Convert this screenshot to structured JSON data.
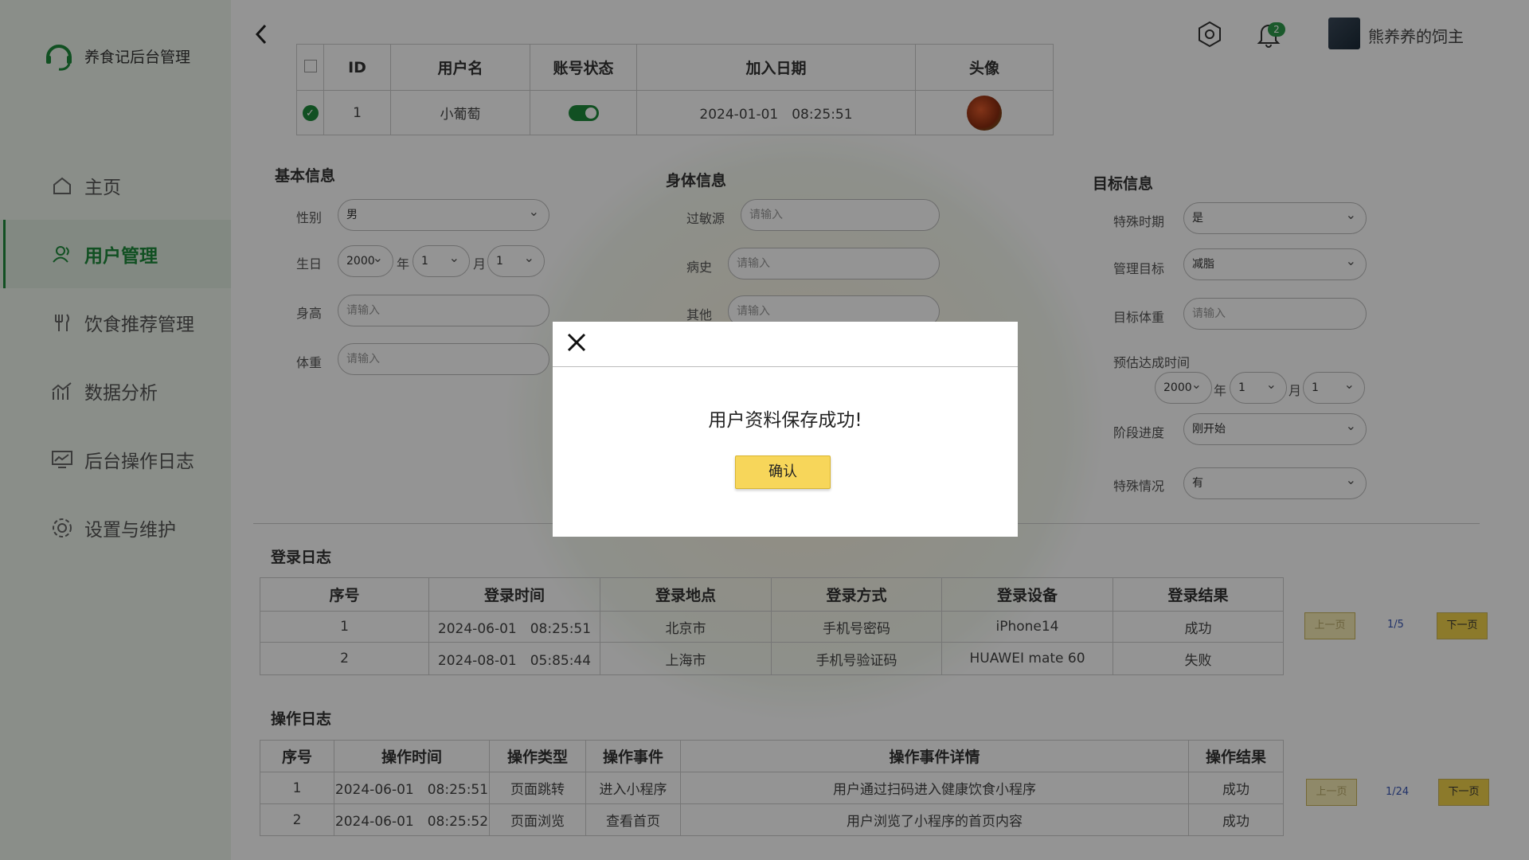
{
  "app": {
    "title": "养食记后台管理"
  },
  "sidebar": {
    "items": [
      {
        "label": "主页",
        "icon": "home-icon"
      },
      {
        "label": "用户管理",
        "icon": "user-icon",
        "active": true
      },
      {
        "label": "饮食推荐管理",
        "icon": "utensils-icon"
      },
      {
        "label": "数据分析",
        "icon": "chart-icon"
      },
      {
        "label": "后台操作日志",
        "icon": "monitor-icon"
      },
      {
        "label": "设置与维护",
        "icon": "gear-icon"
      }
    ]
  },
  "header": {
    "notification_count": "2",
    "username": "熊养养的饲主"
  },
  "user_table": {
    "headers": [
      "",
      "ID",
      "用户名",
      "账号状态",
      "加入日期",
      "头像"
    ],
    "row": {
      "id": "1",
      "username": "小葡萄",
      "status_on": true,
      "join_date": "2024-01-01　08:25:51"
    }
  },
  "basic_info": {
    "title": "基本信息",
    "gender_label": "性别",
    "gender_value": "男",
    "birth_label": "生日",
    "birth_year": "2000",
    "year_unit": "年",
    "birth_month": "1",
    "month_unit": "月",
    "birth_day": "1",
    "height_label": "身高",
    "height_placeholder": "请输入",
    "weight_label": "体重",
    "weight_placeholder": "请输入"
  },
  "body_info": {
    "title": "身体信息",
    "allergy_label": "过敏源",
    "allergy_placeholder": "请输入",
    "history_label": "病史",
    "history_placeholder": "请输入",
    "other_label": "其他",
    "other_placeholder": "请输入"
  },
  "goal_info": {
    "title": "目标信息",
    "period_label": "特殊时期",
    "period_value": "是",
    "goal_label": "管理目标",
    "goal_value": "减脂",
    "target_weight_label": "目标体重",
    "target_weight_placeholder": "请输入",
    "eta_label": "预估达成时间",
    "eta_year": "2000",
    "year_unit": "年",
    "eta_month": "1",
    "month_unit": "月",
    "eta_day": "1",
    "stage_label": "阶段进度",
    "stage_value": "刚开始",
    "special_label": "特殊情况",
    "special_value": "有"
  },
  "login_log": {
    "title": "登录日志",
    "headers": [
      "序号",
      "登录时间",
      "登录地点",
      "登录方式",
      "登录设备",
      "登录结果"
    ],
    "rows": [
      [
        "1",
        "2024-06-01　08:25:51",
        "北京市",
        "手机号密码",
        "iPhone14",
        "成功"
      ],
      [
        "2",
        "2024-08-01　05:85:44",
        "上海市",
        "手机号验证码",
        "HUAWEI mate 60",
        "失败"
      ]
    ],
    "prev": "上一页",
    "page": "1/5",
    "next": "下一页"
  },
  "op_log": {
    "title": "操作日志",
    "headers": [
      "序号",
      "操作时间",
      "操作类型",
      "操作事件",
      "操作事件详情",
      "操作结果"
    ],
    "rows": [
      [
        "1",
        "2024-06-01　08:25:51",
        "页面跳转",
        "进入小程序",
        "用户通过扫码进入健康饮食小程序",
        "成功"
      ],
      [
        "2",
        "2024-06-01　08:25:52",
        "页面浏览",
        "查看首页",
        "用户浏览了小程序的首页内容",
        "成功"
      ]
    ],
    "prev": "上一页",
    "page": "1/24",
    "next": "下一页"
  },
  "modal": {
    "message": "用户资料保存成功!",
    "confirm": "确认"
  },
  "colors": {
    "accent": "#1e8a3c",
    "button_yellow": "#f7d65a",
    "sidebar_bg": "#eef5ec"
  }
}
